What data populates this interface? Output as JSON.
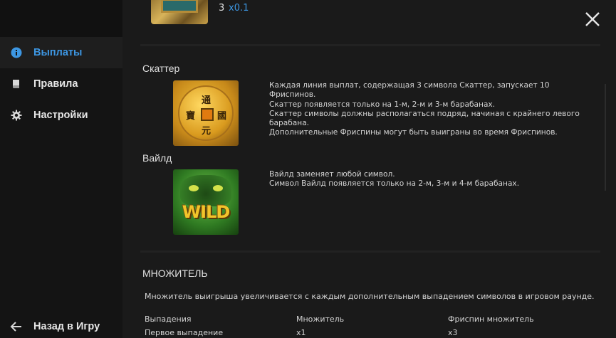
{
  "sidebar": {
    "items": [
      {
        "label": "Выплаты",
        "icon": "info-icon"
      },
      {
        "label": "Правила",
        "icon": "book-icon"
      },
      {
        "label": "Настройки",
        "icon": "gear-icon"
      }
    ],
    "back": {
      "label": "Назад в Игру",
      "icon": "arrow-left-icon"
    }
  },
  "colors": {
    "accent": "#3d97e3",
    "background": "#1a1a1a",
    "sidebar": "#141414"
  },
  "top_row": {
    "count": "3",
    "multiplier": "x0.1"
  },
  "scatter": {
    "title": "Скаттер",
    "lines": [
      "Каждая линия выплат, содержащая 3 символа Скаттер, запускает 10 Фриспинов.",
      "Скаттер появляется только на 1-м, 2-м и 3-м барабанах.",
      "Скаттер символы должны располагаться подряд, начиная с крайнего левого",
      "барабана.",
      "Дополнительные Фриспины могут быть выиграны во время Фриспинов."
    ]
  },
  "wild": {
    "title": "Вайлд",
    "symbol_text": "WILD",
    "lines": [
      "Вайлд заменяет любой символ.",
      "Символ Вайлд появляется только на 2-м, 3-м и 4-м барабанах."
    ]
  },
  "multiplier": {
    "title": "МНОЖИТЕЛЬ",
    "description": "Множитель выигрыша увеличивается с каждым дополнительным выпадением символов в игровом раунде.",
    "headers": [
      "Выпадения",
      "Множитель",
      "Фриспин множитель"
    ],
    "rows": [
      [
        "Первое выпадение",
        "x1",
        "x3"
      ]
    ]
  }
}
